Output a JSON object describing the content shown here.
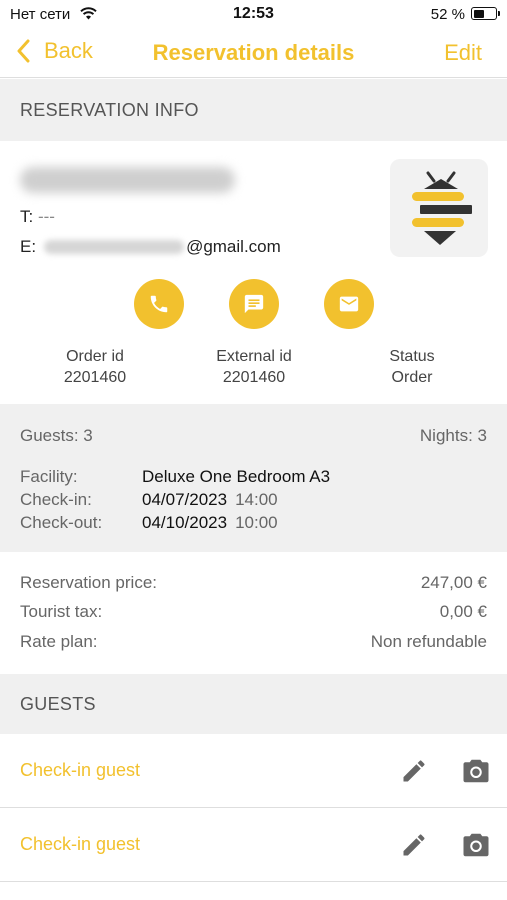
{
  "status_bar": {
    "carrier": "Нет сети",
    "time": "12:53",
    "battery": "52 %",
    "battery_level": 0.52
  },
  "nav": {
    "back_label": "Back",
    "title": "Reservation details",
    "edit_label": "Edit"
  },
  "sections": {
    "reservation_info": "RESERVATION INFO",
    "guests": "GUESTS"
  },
  "contact": {
    "phone_label": "T:",
    "phone_value": "---",
    "email_label": "E:",
    "email_domain": "@gmail.com"
  },
  "actions": [
    {
      "icon": "phone-icon"
    },
    {
      "icon": "message-icon"
    },
    {
      "icon": "mail-icon"
    }
  ],
  "meta": [
    {
      "label": "Order id",
      "value": "2201460"
    },
    {
      "label": "External id",
      "value": "2201460"
    },
    {
      "label": "Status",
      "value": "Order"
    }
  ],
  "stay": {
    "guests": "Guests: 3",
    "nights": "Nights: 3",
    "facility_label": "Facility:",
    "facility_value": "Deluxe One Bedroom A3",
    "checkin_label": "Check-in:",
    "checkin_date": "04/07/2023",
    "checkin_time": "14:00",
    "checkout_label": "Check-out:",
    "checkout_date": "04/10/2023",
    "checkout_time": "10:00"
  },
  "prices": [
    {
      "label": "Reservation price:",
      "value": "247,00 €"
    },
    {
      "label": "Tourist tax:",
      "value": "0,00 €"
    },
    {
      "label": "Rate plan:",
      "value": "Non refundable"
    }
  ],
  "guest_rows": [
    {
      "label": "Check-in guest"
    },
    {
      "label": "Check-in guest"
    }
  ],
  "colors": {
    "accent": "#f2c12e",
    "section_bg": "#f0f0f0",
    "logo_dark": "#333333"
  }
}
